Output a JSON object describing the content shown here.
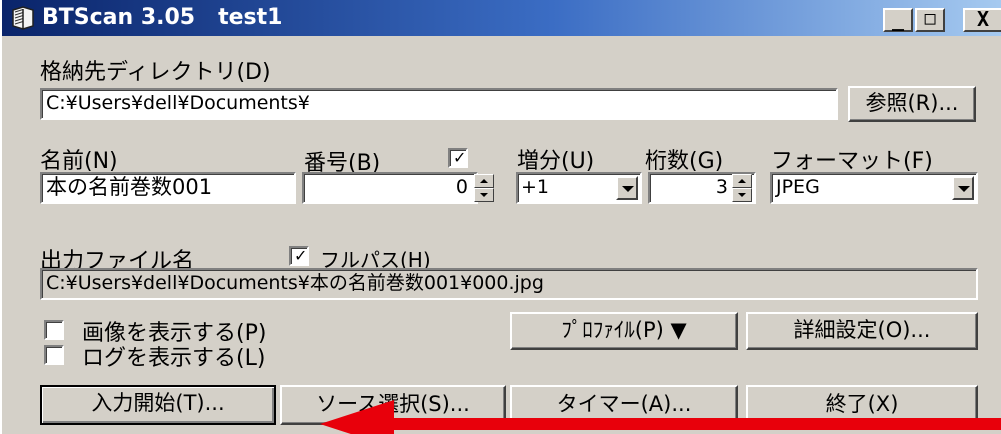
{
  "window": {
    "title": "BTScan 3.05   test1",
    "minimize_glyph": "_",
    "maximize_glyph": "□",
    "close_glyph": "X"
  },
  "storage": {
    "label": "格納先ディレクトリ(D)",
    "path": "C:¥Users¥dell¥Documents¥",
    "browse_label": "参照(R)..."
  },
  "name_row": {
    "name_label": "名前(N)",
    "name_value": "本の名前巻数001",
    "number_label": "番号(B)",
    "number_enabled_mark": "✓",
    "number_value": "0",
    "increment_label": "増分(U)",
    "increment_value": "+1",
    "digits_label": "桁数(G)",
    "digits_value": "3",
    "format_label": "フォーマット(F)",
    "format_value": "JPEG"
  },
  "output": {
    "label": "出力ファイル名",
    "fullpath_mark": "✓",
    "fullpath_label": "フルパス(H)",
    "value": "C:¥Users¥dell¥Documents¥本の名前巻数001¥000.jpg"
  },
  "options": {
    "show_image_label": "画像を表示する(P)",
    "show_log_label": "ログを表示する(L)",
    "profile_label": "ﾌﾟﾛﾌｧｲﾙ(P) ▼",
    "advanced_label": "詳細設定(O)..."
  },
  "actions": {
    "start_label": "入力開始(T)...",
    "source_label": "ソース選択(S)...",
    "timer_label": "タイマー(A)...",
    "exit_label": "終了(X)"
  },
  "annotation": {
    "arrow_color": "#e8000b"
  }
}
